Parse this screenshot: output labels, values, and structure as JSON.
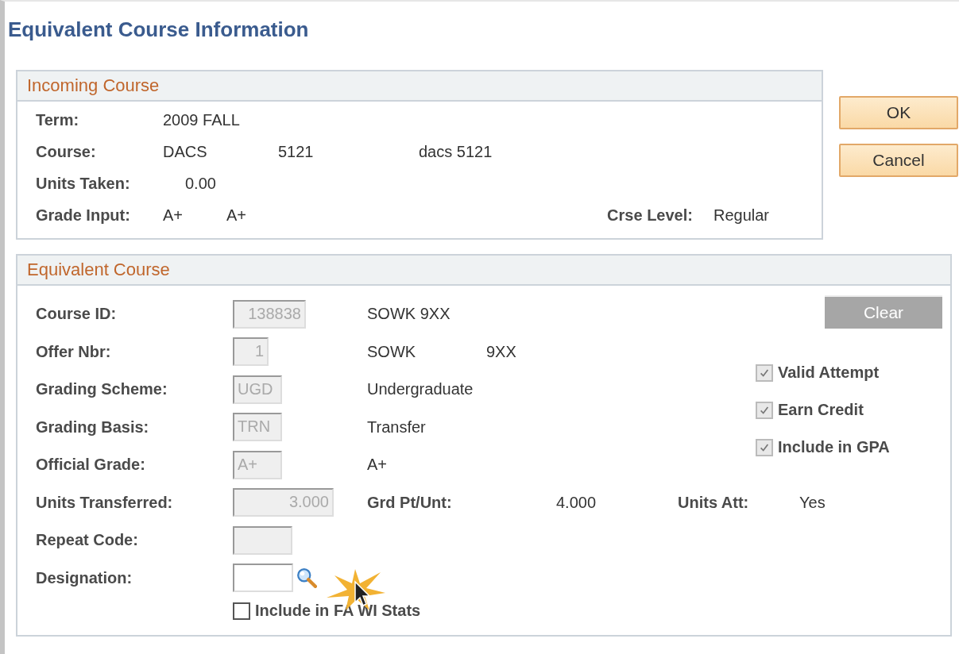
{
  "title": "Equivalent Course Information",
  "incoming": {
    "header": "Incoming Course",
    "rows": [
      {
        "label": "Term:",
        "values": [
          "2009 FALL"
        ]
      },
      {
        "label": "Course:",
        "values": [
          "DACS",
          "5121",
          "dacs 5121"
        ]
      },
      {
        "label": "Units Taken:",
        "values": [
          "0.00"
        ]
      },
      {
        "label": "Grade Input:",
        "values": [
          "A+",
          "A+"
        ],
        "side_label": "Crse Level:",
        "side_value": "Regular"
      }
    ]
  },
  "buttons": [
    {
      "label": "OK"
    },
    {
      "label": "Cancel"
    }
  ],
  "equivalent": {
    "header": "Equivalent Course",
    "rows": [
      {
        "kind": "field",
        "label": "Course ID:",
        "value": "138838",
        "disabled": true,
        "descriptions": [
          "SOWK 9XX"
        ]
      },
      {
        "kind": "field",
        "label": "Offer Nbr:",
        "value": "1",
        "disabled": true,
        "descriptions": [
          "SOWK",
          "9XX"
        ]
      },
      {
        "kind": "field",
        "label": "Grading Scheme:",
        "value": "UGD",
        "disabled": true,
        "descriptions": [
          "Undergraduate"
        ]
      },
      {
        "kind": "field",
        "label": "Grading Basis:",
        "value": "TRN",
        "disabled": true,
        "descriptions": [
          "Transfer"
        ]
      },
      {
        "kind": "field",
        "label": "Official Grade:",
        "value": "A+",
        "disabled": true,
        "descriptions": [
          "A+"
        ]
      },
      {
        "kind": "field",
        "label": "Units Transferred:",
        "value": "3.000",
        "disabled": true,
        "extras": [
          {
            "kind": "label",
            "text": "Grd Pt/Unt:"
          },
          {
            "kind": "value",
            "text": "4.000"
          },
          {
            "kind": "label",
            "text": "Units Att:"
          },
          {
            "kind": "value",
            "text": "Yes"
          }
        ]
      },
      {
        "kind": "field",
        "label": "Repeat Code:",
        "disabled": true
      },
      {
        "kind": "lookup",
        "label": "Designation:",
        "disabled": false
      }
    ],
    "clear_button": {
      "label": "Clear",
      "disabled": true
    },
    "flags": [
      {
        "label": "Valid Attempt",
        "checked": true,
        "disabled": true
      },
      {
        "label": "Earn Credit",
        "checked": true,
        "disabled": true
      },
      {
        "label": "Include in GPA",
        "checked": true,
        "disabled": true
      }
    ],
    "bottom_checkbox": {
      "label": "Include in FA WI Stats",
      "checked": false,
      "disabled": false
    }
  }
}
